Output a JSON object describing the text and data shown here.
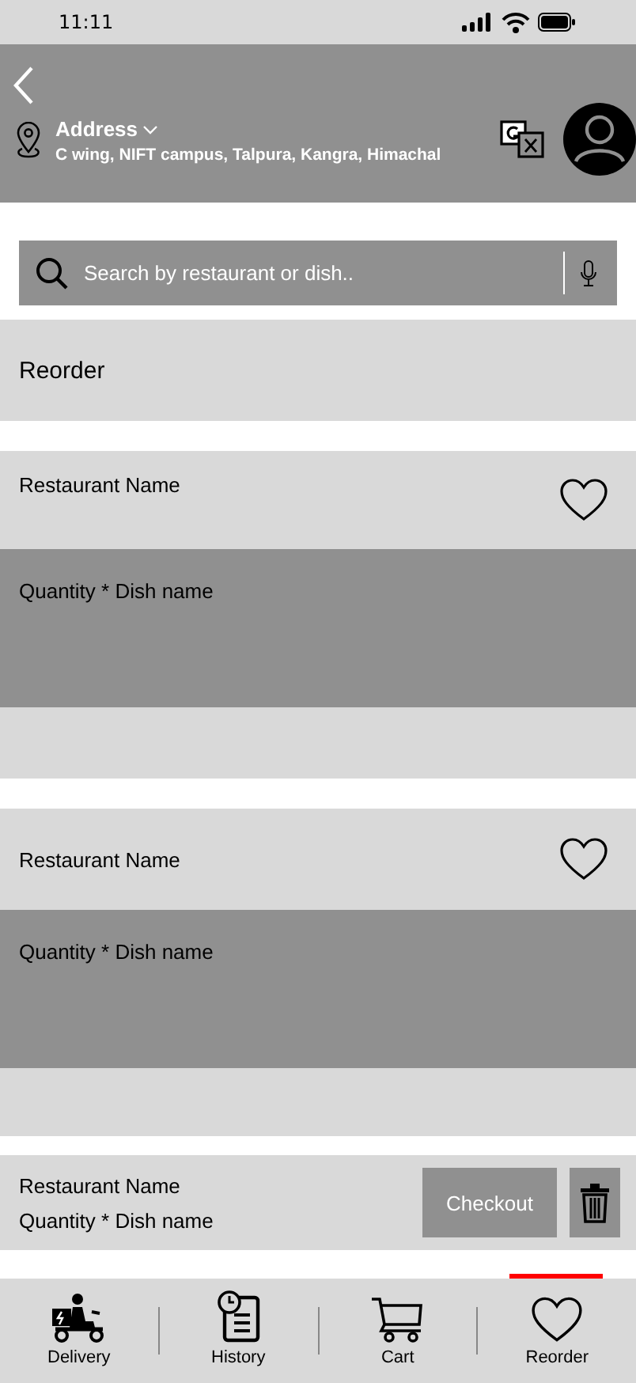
{
  "status_bar": {
    "time": "11:11"
  },
  "header": {
    "address_label": "Address",
    "address": "C wing, NIFT campus, Talpura, Kangra, Himachal"
  },
  "search": {
    "placeholder": "Search by restaurant or dish.."
  },
  "section_title": "Reorder",
  "orders": [
    {
      "restaurant": "Restaurant Name",
      "items": "Quantity * Dish name",
      "favorite": false
    },
    {
      "restaurant": "Restaurant Name",
      "items": "Quantity * Dish name",
      "favorite": false
    }
  ],
  "cart_bar": {
    "restaurant": "Restaurant Name",
    "items": "Quantity * Dish name",
    "button": "Checkout"
  },
  "nav": [
    {
      "kind": "delivery",
      "label": "Delivery",
      "selected": false
    },
    {
      "kind": "history",
      "label": "History",
      "selected": false
    },
    {
      "kind": "cart",
      "label": "Cart",
      "selected": false
    },
    {
      "kind": "reorder",
      "label": "Reorder",
      "selected": true
    }
  ]
}
